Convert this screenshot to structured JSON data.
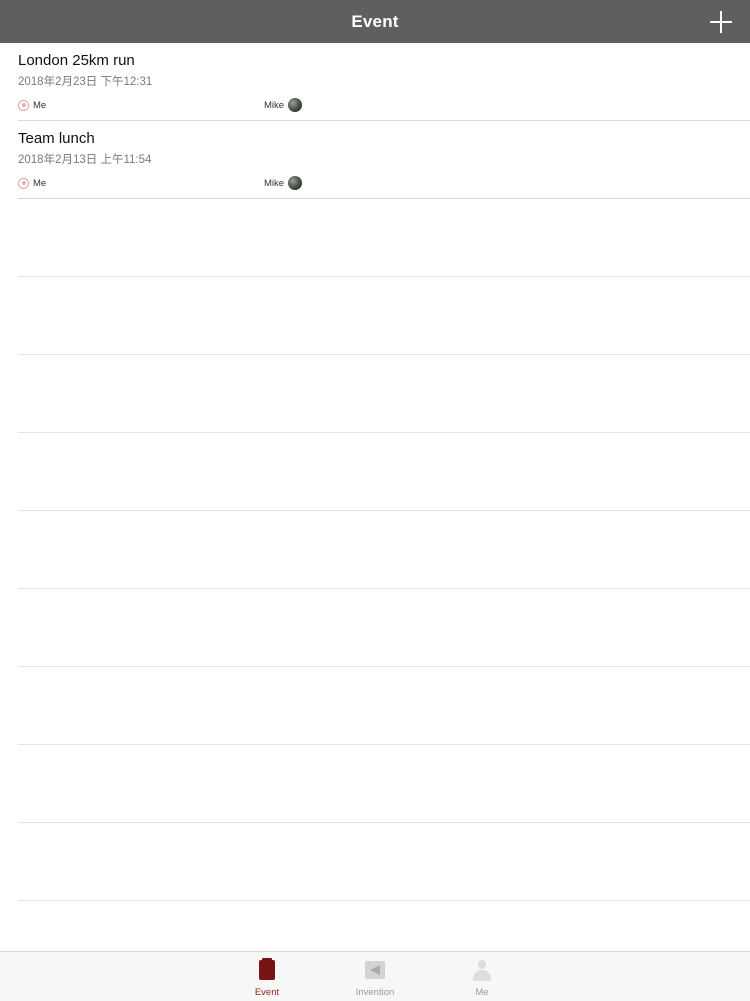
{
  "navbar": {
    "title": "Event"
  },
  "events": [
    {
      "title": "London 25km run",
      "date": "2018年2月23日 下午12:31",
      "me_label": "Me",
      "participant": "Mike"
    },
    {
      "title": "Team lunch",
      "date": "2018年2月13日 上午11:54",
      "me_label": "Me",
      "participant": "Mike"
    }
  ],
  "tabbar": {
    "tabs": [
      {
        "label": "Event",
        "icon": "calendar-icon",
        "active": true
      },
      {
        "label": "Invention",
        "icon": "envelope-icon",
        "active": false
      },
      {
        "label": "Me",
        "icon": "person-icon",
        "active": false
      }
    ]
  },
  "colors": {
    "navbar_bg": "#5f5f61",
    "accent": "#8a2a1f",
    "separator": "#d9d9d9"
  }
}
